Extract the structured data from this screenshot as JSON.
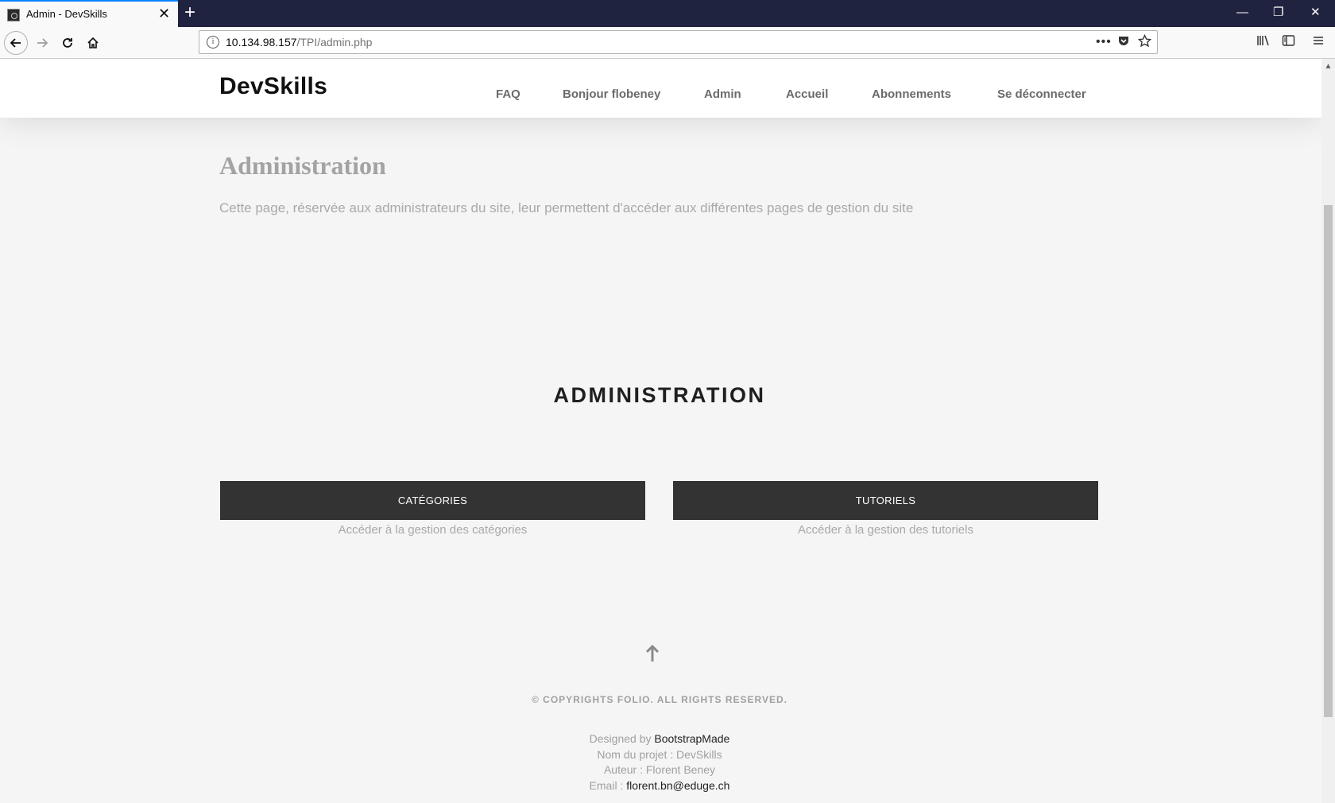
{
  "browser": {
    "tab_title": "Admin - DevSkills",
    "tab_close": "✕",
    "new_tab": "+",
    "url_host": "10.134.98.157",
    "url_path": "/TPI/admin.php",
    "window_controls": {
      "minimize": "—",
      "restore": "❐",
      "close": "✕"
    }
  },
  "site": {
    "logo": "DevSkills",
    "menu": [
      "FAQ",
      "Bonjour flobeney",
      "Admin",
      "Accueil",
      "Abonnements",
      "Se déconnecter"
    ]
  },
  "intro": {
    "title": "Administration",
    "text": "Cette page, réservée aux administrateurs du site, leur permettent d'accéder aux différentes pages de gestion du site"
  },
  "section": {
    "title": "ADMINISTRATION",
    "cards": [
      {
        "button": "CATÉGORIES",
        "description": "Accéder à la gestion des catégories"
      },
      {
        "button": "TUTORIELS",
        "description": "Accéder à la gestion des tutoriels"
      }
    ]
  },
  "footer": {
    "copyright": "© COPYRIGHTS FOLIO. ALL RIGHTS RESERVED.",
    "designed_prefix": "Designed by ",
    "designed_by": "BootstrapMade",
    "project": "Nom du projet : DevSkills",
    "author": "Auteur : Florent Beney",
    "email_prefix": "Email : ",
    "email": "florent.bn@eduge.ch"
  }
}
